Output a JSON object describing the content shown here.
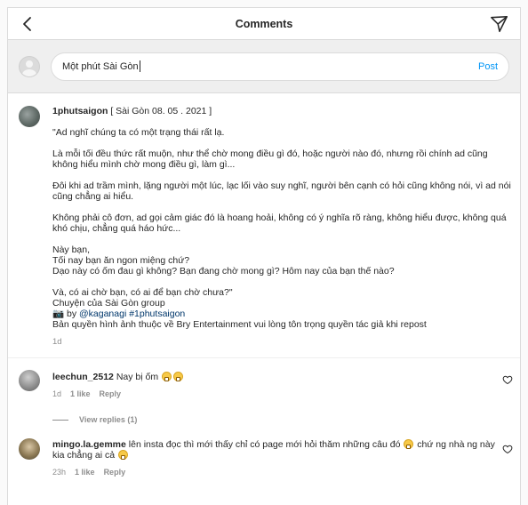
{
  "header": {
    "title": "Comments"
  },
  "composer": {
    "value": "Một phút Sài Gòn",
    "post_label": "Post"
  },
  "post": {
    "username": "1phutsaigon",
    "lines": [
      " [ Sài Gòn 08. 05 . 2021 ]",
      "",
      "\"Ad nghĩ chúng ta có một trạng thái rất lạ.",
      "",
      "Là mỗi tối đều thức rất muộn, như thể chờ mong điều gì đó, hoặc người nào đó, nhưng rồi chính ad cũng",
      "không hiểu mình chờ mong điều gì, làm gì...",
      "",
      "Đôi khi ad trầm mình, lặng người một lúc, lạc lối vào suy nghĩ, người bên cạnh có hỏi cũng không nói, vì ad nói",
      "cũng chẳng ai hiểu.",
      "",
      "Không phải cô đơn, ad gọi cảm giác đó là hoang hoải, không có ý nghĩa rõ ràng, không hiểu được, không quá",
      "khó chịu, chẳng quá háo hức...",
      "",
      "Này bạn,",
      "Tối nay bạn ăn ngon miệng chứ?",
      "Dạo này có ốm đau gì không? Bạn đang chờ mong gì? Hôm nay của bạn thế nào?",
      "",
      "Và, có ai chờ bạn, có ai để bạn chờ chưa?\"",
      "Chuyện của Sài Gòn group"
    ],
    "credit_prefix": "📷 by ",
    "credit_handle": "@kaganagi",
    "credit_tag": "#1phutsaigon",
    "copyright": "Bản quyền hình ảnh thuộc về Bry Entertainment vui lòng tôn trọng quyền tác giả khi repost",
    "time": "1d"
  },
  "comments": [
    {
      "username": "leechun_2512",
      "text": "Nay bị ốm",
      "time": "1d",
      "likes": "1 like",
      "reply_label": "Reply",
      "view_replies": "View replies (1)"
    },
    {
      "username": "mingo.la.gemme",
      "text_line1": "lên insta đọc thì mới thấy chỉ có page mới hỏi thăm những câu đó",
      "text_line1b": "chứ ng nhà ng này",
      "text_line2": "kia chẳng ai cả",
      "time": "23h",
      "likes": "1 like",
      "reply_label": "Reply"
    }
  ]
}
